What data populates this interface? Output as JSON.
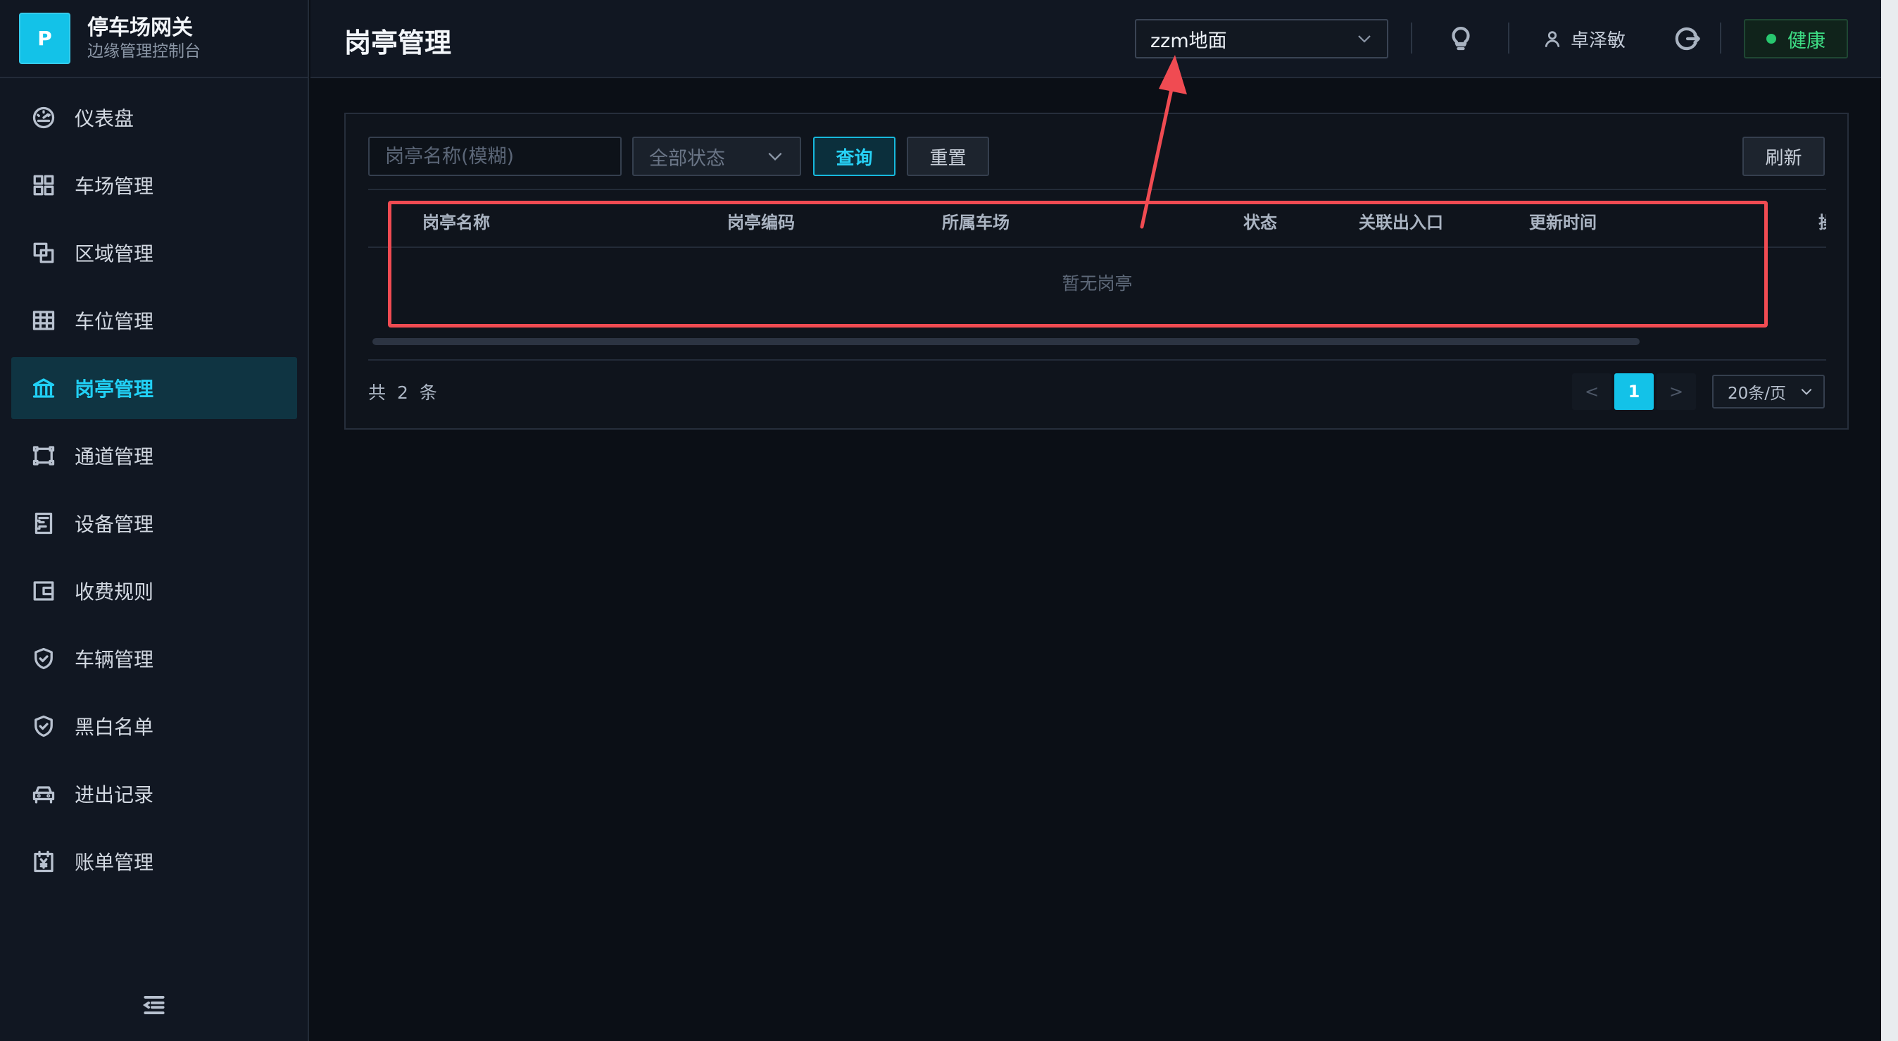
{
  "brand": {
    "logo_letter": "P",
    "title": "停车场网关",
    "subtitle": "边缘管理控制台"
  },
  "sidebar": {
    "items": [
      {
        "label": "仪表盘",
        "icon": "gauge-icon",
        "active": false
      },
      {
        "label": "车场管理",
        "icon": "grid-icon",
        "active": false
      },
      {
        "label": "区域管理",
        "icon": "layers-icon",
        "active": false
      },
      {
        "label": "车位管理",
        "icon": "table-icon",
        "active": false
      },
      {
        "label": "岗亭管理",
        "icon": "bank-icon",
        "active": true
      },
      {
        "label": "通道管理",
        "icon": "channel-icon",
        "active": false
      },
      {
        "label": "设备管理",
        "icon": "device-icon",
        "active": false
      },
      {
        "label": "收费规则",
        "icon": "wallet-icon",
        "active": false
      },
      {
        "label": "车辆管理",
        "icon": "shield-check-icon",
        "active": false
      },
      {
        "label": "黑白名单",
        "icon": "shield-check-icon",
        "active": false
      },
      {
        "label": "进出记录",
        "icon": "car-icon",
        "active": false
      },
      {
        "label": "账单管理",
        "icon": "bill-icon",
        "active": false
      }
    ],
    "collapse_icon": "menu-fold-icon"
  },
  "header": {
    "title": "岗亭管理",
    "park_select": "zzm地面",
    "user": "卓泽敏",
    "health": "健康"
  },
  "filters": {
    "name_placeholder": "岗亭名称(模糊)",
    "status_value": "全部状态",
    "query_label": "查询",
    "reset_label": "重置",
    "refresh_label": "刷新"
  },
  "table": {
    "columns": [
      "岗亭名称",
      "岗亭编码",
      "所属车场",
      "状态",
      "关联出入口",
      "更新时间",
      "操"
    ],
    "empty_text": "暂无岗亭"
  },
  "pagination": {
    "total_text": "共 2 条",
    "prev": "<",
    "current": "1",
    "next": ">",
    "page_size": "20条/页"
  },
  "colors": {
    "accent": "#13c2e8",
    "annotation": "#f04b52",
    "health": "#28c76f"
  }
}
